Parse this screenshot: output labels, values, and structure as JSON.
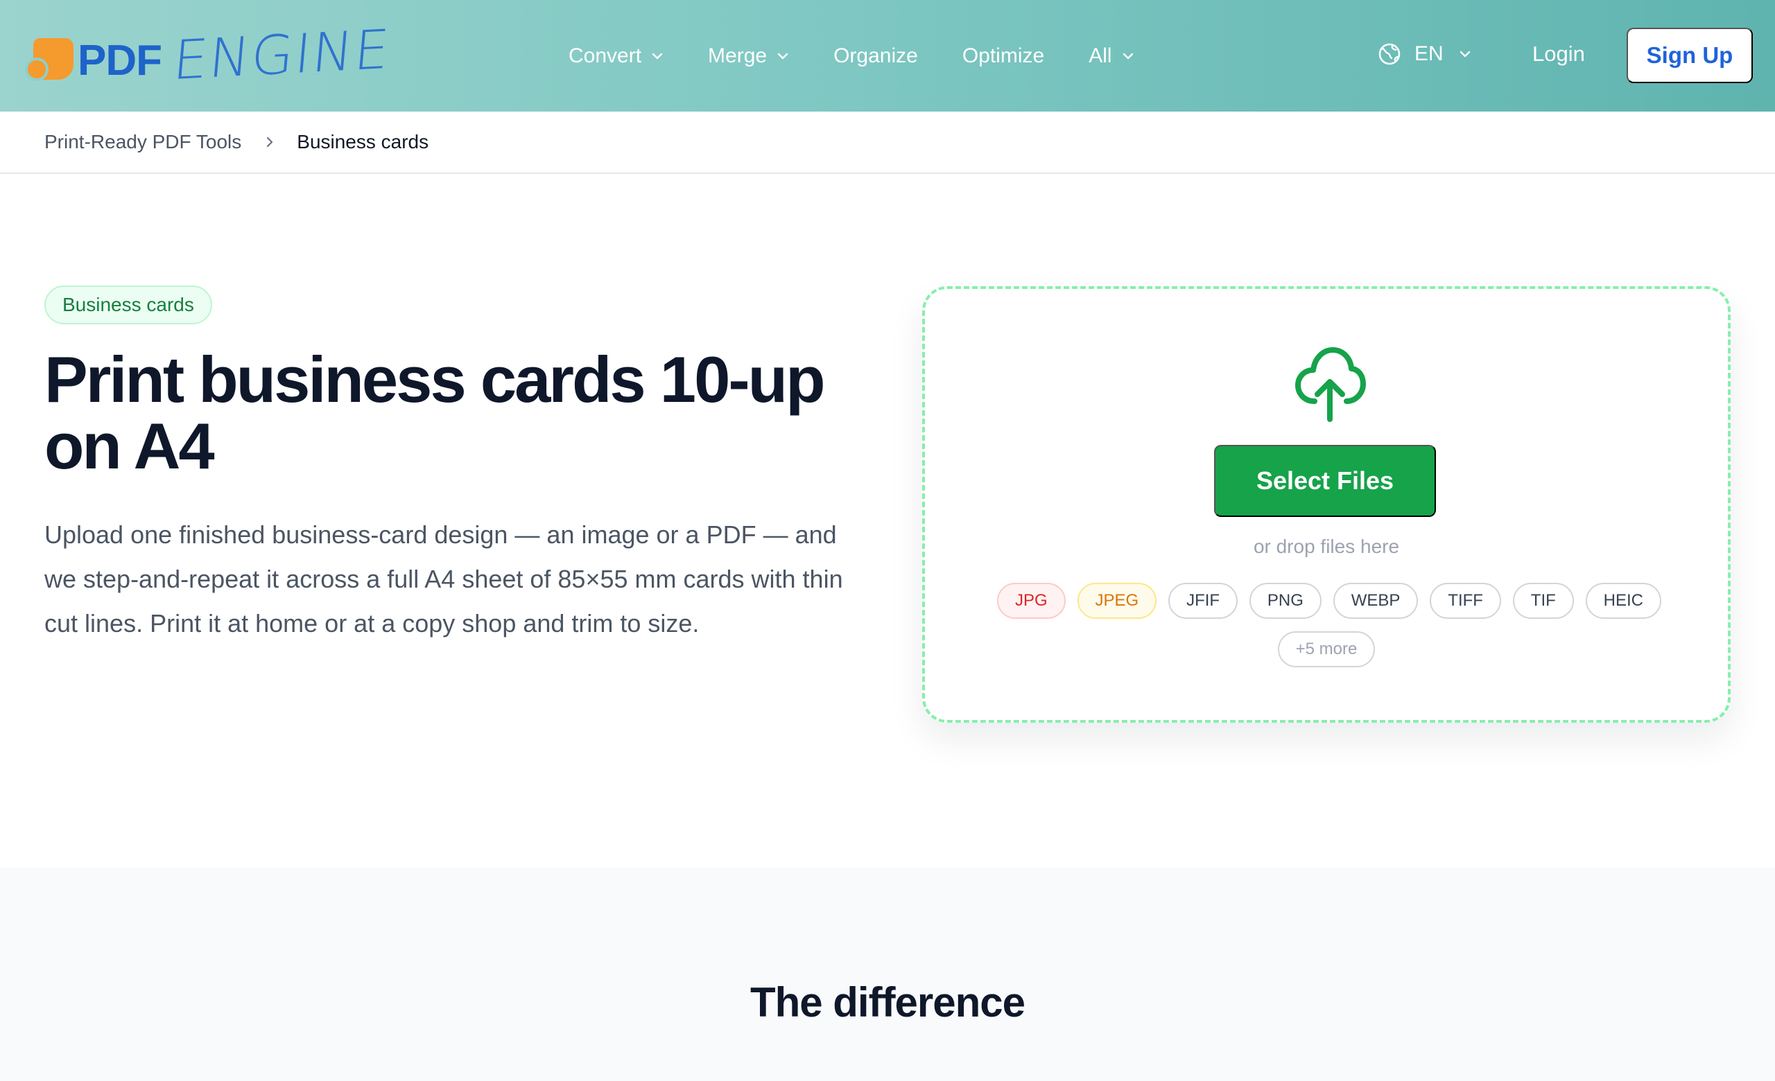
{
  "brand": {
    "logo_pdf": "PDF",
    "logo_engine": "ENGINE",
    "colors": {
      "accent": "#16a34a",
      "brand_blue": "#1f63d9",
      "logo_orange": "#f59a2c"
    }
  },
  "nav": {
    "items": [
      {
        "label": "Convert",
        "has_dropdown": true
      },
      {
        "label": "Merge",
        "has_dropdown": true
      },
      {
        "label": "Organize",
        "has_dropdown": false
      },
      {
        "label": "Optimize",
        "has_dropdown": false
      },
      {
        "label": "All",
        "has_dropdown": true
      }
    ],
    "language": "EN",
    "login": "Login",
    "signup": "Sign Up"
  },
  "breadcrumb": {
    "parent": "Print-Ready PDF Tools",
    "current": "Business cards"
  },
  "hero": {
    "badge": "Business cards",
    "title": "Print business cards 10-up on A4",
    "description": "Upload one finished business-card design — an image or a PDF — and we step-and-repeat it across a full A4 sheet of 85×55 mm cards with thin cut lines. Print it at home or at a copy shop and trim to size."
  },
  "dropzone": {
    "button": "Select Files",
    "hint": "or drop files here",
    "formats": [
      "JPG",
      "JPEG",
      "JFIF",
      "PNG",
      "WEBP",
      "TIFF",
      "TIF",
      "HEIC"
    ],
    "more": "+5 more"
  },
  "section": {
    "title": "The difference"
  }
}
